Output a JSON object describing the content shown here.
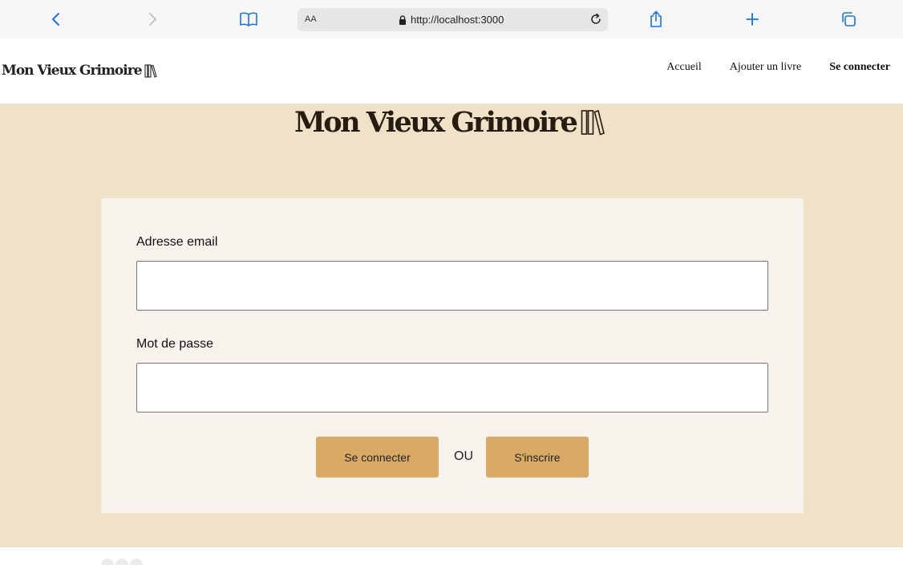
{
  "browser": {
    "text_size_label": "AA",
    "url": "http://localhost:3000",
    "icons": [
      "back-icon",
      "forward-icon",
      "bookmarks-icon",
      "lock-icon",
      "reload-icon",
      "share-icon",
      "new-tab-icon",
      "tabs-icon"
    ]
  },
  "header": {
    "logo": "Mon Vieux Grimoire",
    "nav": [
      {
        "label": "Accueil",
        "active": false
      },
      {
        "label": "Ajouter un livre",
        "active": false
      },
      {
        "label": "Se connecter",
        "active": true
      }
    ]
  },
  "main": {
    "title": "Mon Vieux Grimoire",
    "form": {
      "email_label": "Adresse email",
      "email_value": "",
      "password_label": "Mot de passe",
      "password_value": "",
      "login_button": "Se connecter",
      "or_text": "OU",
      "signup_button": "S'inscrire"
    }
  },
  "colors": {
    "accent": "#d8aa65",
    "main_background": "#f0e2c9",
    "card_background": "#f7f2ec",
    "browser_accent": "#1a73e8"
  }
}
